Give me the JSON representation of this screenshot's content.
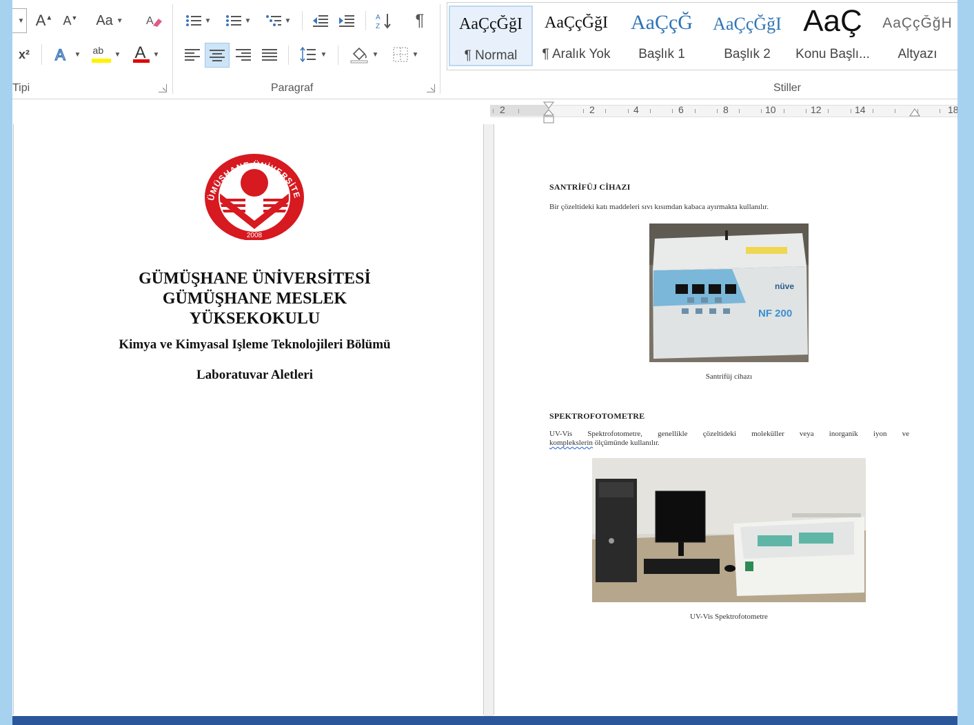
{
  "ribbon": {
    "font_group_label": "Tipi",
    "paragraph_group_label": "Paragraf",
    "styles_group_label": "Stiller",
    "font_case_label": "Aa",
    "superscript_label": "x²",
    "highlight_label": "ab",
    "font_color_label": "A"
  },
  "styles": [
    {
      "sample": "AaÇçĞğI",
      "name": "¶ Normal",
      "selected": true
    },
    {
      "sample": "AaÇçĞğI",
      "name": "¶ Aralık Yok",
      "selected": false
    },
    {
      "sample": "AaÇçĞ",
      "name": "Başlık 1",
      "selected": false
    },
    {
      "sample": "AaÇçĞğI",
      "name": "Başlık 2",
      "selected": false
    },
    {
      "sample": "AaÇ",
      "name": "Konu Başlı...",
      "selected": false
    },
    {
      "sample": "AaÇçĞğH",
      "name": "Altyazı",
      "selected": false
    }
  ],
  "ruler": {
    "numbers": [
      "2",
      "2",
      "4",
      "6",
      "8",
      "10",
      "12",
      "14",
      "18"
    ]
  },
  "page1": {
    "seal_text": "GÜMÜŞHANE ÜNİVERSİTESİ",
    "seal_year": "2008",
    "title_line1": "GÜMÜŞHANE ÜNİVERSİTESİ",
    "title_line2": "GÜMÜŞHANE MESLEK",
    "title_line3": "YÜKSEKOKULU",
    "department": "Kimya ve Kimyasal Işleme Teknolojileri Bölümü",
    "subtitle": "Laboratuvar Aletleri"
  },
  "page2": {
    "section1_heading": "SANTRİFÜJ CİHAZI",
    "section1_text": "Bir çözeltideki katı maddeleri sıvı kısımdan kabaca ayırmakta kullanılır.",
    "centrifuge_brand": "nüve",
    "centrifuge_model": "NF 200",
    "section1_caption": "Santrifüj cihazı",
    "section2_heading": "SPEKTROFOTOMETRE",
    "section2_text_line1": "UV-Vis Spektrofotometre, genellikle çözeltideki moleküller veya inorganik iyon ve",
    "section2_text_word": "komplekslerin",
    "section2_text_line2": " ölçümünde kullanılır.",
    "section2_caption": "UV-Vis Spektrofotometre"
  },
  "colors": {
    "accent": "#2b579a",
    "window_edge": "#a6d2ef",
    "seal_red": "#d71920"
  }
}
